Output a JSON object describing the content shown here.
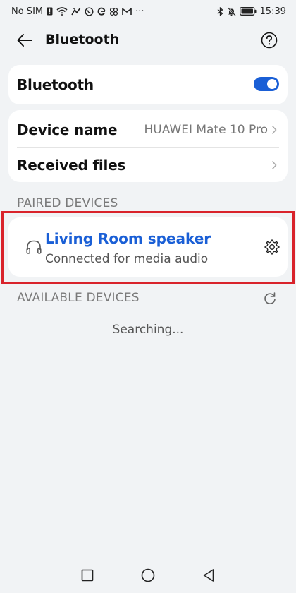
{
  "status_bar": {
    "carrier": "No SIM",
    "more": "···",
    "time": "15:39",
    "icons_left": [
      "sim-alert-icon",
      "wifi-icon",
      "signal-activity-icon",
      "whatsapp-icon",
      "google-icon",
      "app-icon",
      "gmail-icon"
    ],
    "icons_right": [
      "bluetooth-icon",
      "mute-icon",
      "battery-icon"
    ]
  },
  "app_bar": {
    "title": "Bluetooth"
  },
  "bluetooth_card": {
    "label": "Bluetooth",
    "enabled": true,
    "accent": "#1a5fd6"
  },
  "settings_card": {
    "device_name_label": "Device name",
    "device_name_value": "HUAWEI Mate 10 Pro",
    "received_files_label": "Received files"
  },
  "paired": {
    "header": "PAIRED DEVICES",
    "devices": [
      {
        "name": "Living Room speaker",
        "status": "Connected for media audio",
        "icon": "headphones-icon"
      }
    ],
    "highlight_color": "#d9232b"
  },
  "available": {
    "header": "AVAILABLE DEVICES",
    "status": "Searching..."
  },
  "nav": {
    "buttons": [
      "recents",
      "home",
      "back"
    ]
  }
}
